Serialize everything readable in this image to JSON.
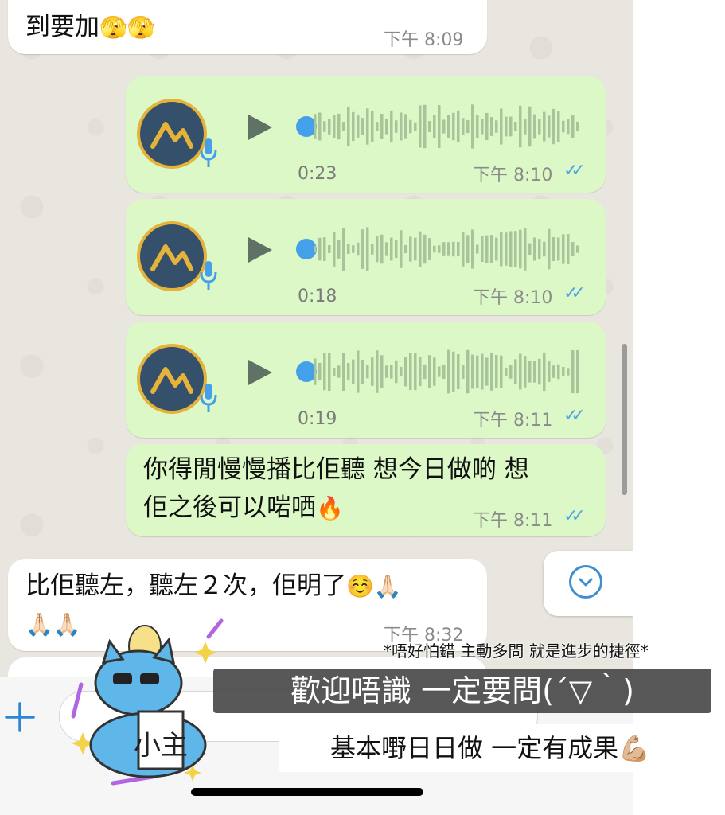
{
  "colors": {
    "incoming_bubble": "#ffffff",
    "outgoing_bubble": "#dcf8c6",
    "read_ticks": "#4fa6e6",
    "playhead": "#45a0ea"
  },
  "messages": [
    {
      "id": "m1",
      "direction": "incoming",
      "text": "到要加",
      "emoji": "🫣🫣",
      "time": "下午 8:09"
    },
    {
      "id": "m2",
      "direction": "outgoing",
      "type": "voice",
      "duration": "0:23",
      "time": "下午 8:10",
      "status": "read"
    },
    {
      "id": "m3",
      "direction": "outgoing",
      "type": "voice",
      "duration": "0:18",
      "time": "下午 8:10",
      "status": "read"
    },
    {
      "id": "m4",
      "direction": "outgoing",
      "type": "voice",
      "duration": "0:19",
      "time": "下午 8:11",
      "status": "read"
    },
    {
      "id": "m5",
      "direction": "outgoing",
      "line1": "你得閒慢慢播比佢聽 想今日做啲 想",
      "line2": "佢之後可以啱哂",
      "emoji": "🔥",
      "time": "下午 8:11",
      "status": "read"
    },
    {
      "id": "m6",
      "direction": "incoming",
      "line1": "比佢聽左，聽左２次，佢明了",
      "line1_emoji": "☺️🙏🏻",
      "line2_emoji": "🙏🏻🙏🏻",
      "time": "下午 8:32"
    }
  ],
  "voice_avatar_icon": "mountain-logo-icon",
  "input": {
    "plus_icon": "plus-icon",
    "placeholder": ""
  },
  "overlay": {
    "caption_small": "*唔好怕錯 主動多問 就是進步的捷徑*",
    "caption_main": "歡迎唔識 一定要問(´▽｀)",
    "caption_sub": "基本嘢日日做 一定有成果",
    "caption_sub_emoji": "💪🏼",
    "sticker_text": "小主"
  }
}
